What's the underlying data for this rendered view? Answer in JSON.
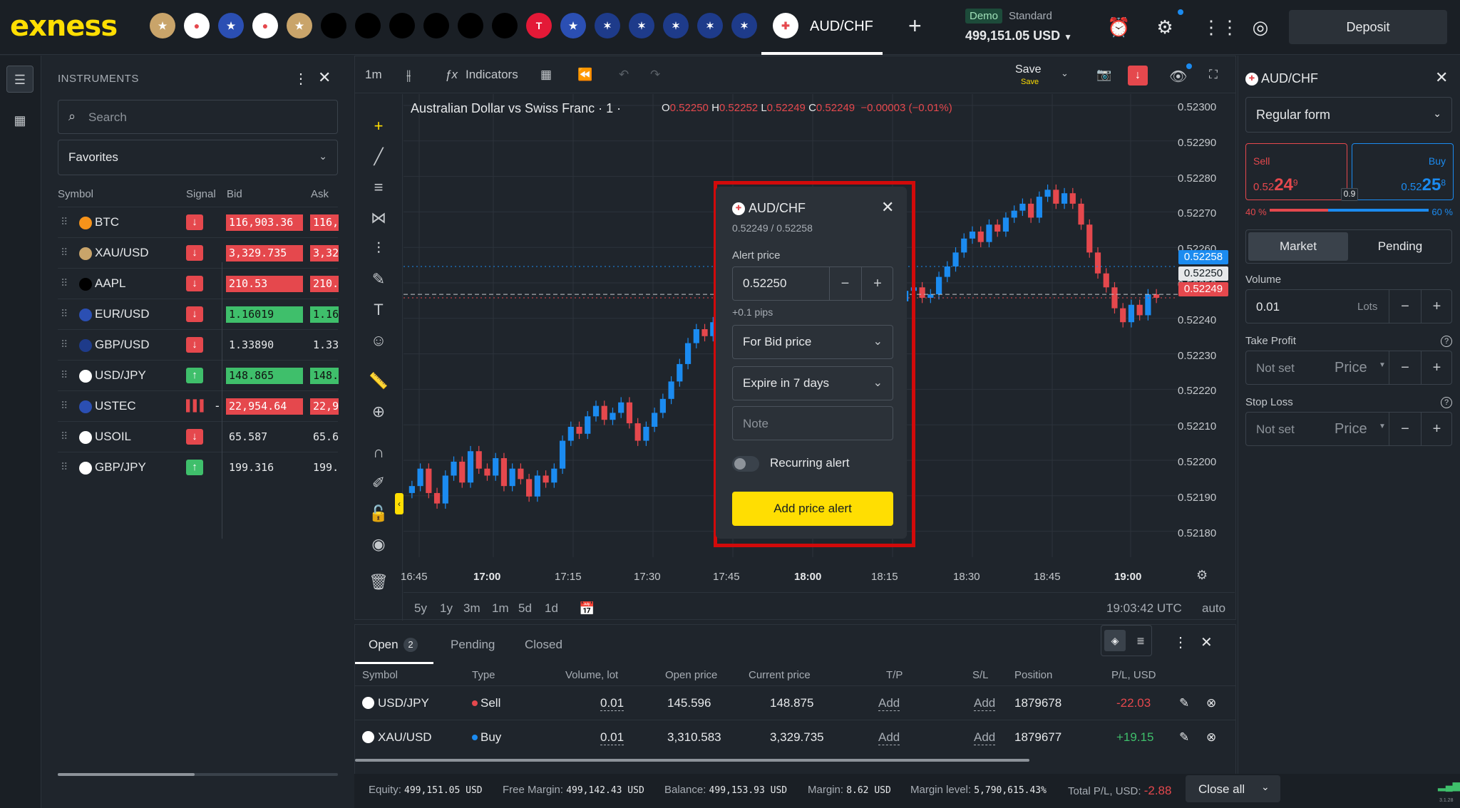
{
  "topbar": {
    "logo": "exness",
    "active_tab": "AUD/CHF",
    "demo_badge": "Demo",
    "account_type": "Standard",
    "balance": "499,151.05 USD",
    "deposit_label": "Deposit",
    "tabs_icons": [
      "xau-usd",
      "usd-jpy",
      "eur-usd",
      "gbp-jpy",
      "xau-usd",
      "aapl",
      "aapl",
      "aapl",
      "aapl",
      "aapl",
      "aapl",
      "tesla",
      "eur-usd",
      "aud-usd",
      "aud-usd",
      "aud-usd",
      "aud-usd",
      "aud-usd"
    ]
  },
  "instruments": {
    "title": "INSTRUMENTS",
    "search_placeholder": "Search",
    "filter_value": "Favorites",
    "columns": [
      "Symbol",
      "Signal",
      "Bid",
      "Ask"
    ],
    "rows": [
      {
        "symbol": "BTC",
        "signal": "down",
        "bid": "116,903.36",
        "ask": "116,",
        "bid_color": "red"
      },
      {
        "symbol": "XAU/USD",
        "signal": "down",
        "bid": "3,329.735",
        "ask": "3,32",
        "bid_color": "red"
      },
      {
        "symbol": "AAPL",
        "signal": "down",
        "bid": "210.53",
        "ask": "210.",
        "bid_color": "red"
      },
      {
        "symbol": "EUR/USD",
        "signal": "down",
        "bid": "1.16019",
        "ask": "1.16",
        "bid_color": "green"
      },
      {
        "symbol": "GBP/USD",
        "signal": "down",
        "bid": "1.33890",
        "ask": "1.33",
        "bid_color": "none"
      },
      {
        "symbol": "USD/JPY",
        "signal": "up",
        "bid": "148.865",
        "ask": "148.",
        "bid_color": "green"
      },
      {
        "symbol": "USTEC",
        "signal": "none",
        "bid": "22,954.64",
        "ask": "22,9",
        "bid_color": "red"
      },
      {
        "symbol": "USOIL",
        "signal": "down",
        "bid": "65.587",
        "ask": "65.6",
        "bid_color": "none"
      },
      {
        "symbol": "GBP/JPY",
        "signal": "up",
        "bid": "199.316",
        "ask": "199.",
        "bid_color": "none"
      }
    ],
    "ustec_signal_text": "-"
  },
  "chart_toolbar": {
    "timeframe": "1m",
    "indicators": "Indicators",
    "save": "Save",
    "save_sub": "Save"
  },
  "chart": {
    "title": "Australian Dollar vs Swiss Franc · 1 ·",
    "ohlc": {
      "o": "0.52250",
      "h": "0.52252",
      "l": "0.52249",
      "c": "0.52249",
      "change": "−0.00003 (−0.01%)"
    },
    "price_axis": [
      "0.52300",
      "0.52290",
      "0.52280",
      "0.52270",
      "0.52260",
      "0.52250",
      "0.52240",
      "0.52230",
      "0.52220",
      "0.52210",
      "0.52200",
      "0.52190",
      "0.52180"
    ],
    "time_axis": [
      "16:45",
      "17:00",
      "17:15",
      "17:30",
      "17:45",
      "18:00",
      "18:15",
      "18:30",
      "18:45",
      "19:00"
    ],
    "tags": {
      "ask": "0.52258",
      "last": "0.52250",
      "bid": "0.52249"
    },
    "ranges": [
      "5y",
      "1y",
      "3m",
      "1m",
      "5d",
      "1d"
    ],
    "clock": "19:03:42 UTC",
    "auto": "auto"
  },
  "chart_data": {
    "type": "candlestick",
    "title": "Australian Dollar vs Swiss Franc · 1 ·",
    "x_range": [
      "16:43",
      "19:03"
    ],
    "ylim": [
      0.52175,
      0.52305
    ],
    "series": [
      {
        "name": "AUD/CHF",
        "close": [
          0.52195,
          0.522,
          0.52193,
          0.5219,
          0.52198,
          0.52202,
          0.52196,
          0.52205,
          0.522,
          0.52198,
          0.52203,
          0.52195,
          0.522,
          0.52197,
          0.52192,
          0.52198,
          0.52196,
          0.522,
          0.52208,
          0.52212,
          0.5221,
          0.52215,
          0.52218,
          0.52214,
          0.52216,
          0.52219,
          0.52213,
          0.52208,
          0.52212,
          0.52216,
          0.5222,
          0.52225,
          0.5223,
          0.52236,
          0.5224,
          0.52238,
          0.52242,
          0.5224,
          0.52244,
          0.52246,
          0.5225,
          0.52254,
          0.52256,
          0.52259,
          0.52254,
          0.52257,
          0.52252,
          0.52254,
          0.52249,
          0.52251,
          0.52248,
          0.5225,
          0.52252,
          0.52251,
          0.52249,
          0.5225,
          0.52253,
          0.5225,
          0.52248,
          0.52251,
          0.52252,
          0.52249,
          0.5225,
          0.52255,
          0.52258,
          0.52262,
          0.52266,
          0.52268,
          0.52265,
          0.5227,
          0.52268,
          0.52272,
          0.52274,
          0.52276,
          0.52272,
          0.52278,
          0.5228,
          0.52276,
          0.52279,
          0.52276,
          0.5227,
          0.52262,
          0.52256,
          0.52252,
          0.52246,
          0.52242,
          0.52247,
          0.52244,
          0.5225,
          0.52249
        ]
      }
    ]
  },
  "alert": {
    "symbol": "AUD/CHF",
    "bid_ask": "0.52249 / 0.52258",
    "price_label": "Alert price",
    "price_value": "0.52250",
    "pips": "+0.1 pips",
    "trigger": "For Bid price",
    "expiry": "Expire in 7 days",
    "note_placeholder": "Note",
    "recurring": "Recurring alert",
    "button": "Add price alert"
  },
  "orders": {
    "tabs": [
      "Open",
      "Pending",
      "Closed"
    ],
    "open_count": "2",
    "columns": [
      "Symbol",
      "Type",
      "Volume, lot",
      "Open price",
      "Current price",
      "T/P",
      "S/L",
      "Position",
      "P/L, USD"
    ],
    "rows": [
      {
        "symbol": "USD/JPY",
        "type": "Sell",
        "volume": "0.01",
        "open": "145.596",
        "current": "148.875",
        "tp": "Add",
        "sl": "Add",
        "position": "1879678",
        "pl": "-22.03"
      },
      {
        "symbol": "XAU/USD",
        "type": "Buy",
        "volume": "0.01",
        "open": "3,310.583",
        "current": "3,329.735",
        "tp": "Add",
        "sl": "Add",
        "position": "1879677",
        "pl": "+19.15"
      }
    ]
  },
  "footer": {
    "equity_l": "Equity:",
    "equity": "499,151.05 USD",
    "free_l": "Free Margin:",
    "free": "499,142.43 USD",
    "balance_l": "Balance:",
    "balance": "499,153.93 USD",
    "margin_l": "Margin:",
    "margin": "8.62 USD",
    "level_l": "Margin level:",
    "level": "5,790,615.43%",
    "total_l": "Total P/L, USD:",
    "total": "-2.88",
    "close_all": "Close all",
    "version": "3.1.28"
  },
  "order_panel": {
    "symbol": "AUD/CHF",
    "form": "Regular form",
    "sell_label": "Sell",
    "sell_small": "0.52",
    "sell_big": "24",
    "sell_sup": "9",
    "buy_label": "Buy",
    "buy_small": "0.52",
    "buy_big": "25",
    "buy_sup": "8",
    "spread": "0.9",
    "sell_pct": "40 %",
    "buy_pct": "60 %",
    "sell_share": 0.4,
    "market": "Market",
    "pending": "Pending",
    "volume_label": "Volume",
    "volume": "0.01",
    "volume_unit": "Lots",
    "tp_label": "Take Profit",
    "tp_value": "Not set",
    "tp_unit": "Price",
    "sl_label": "Stop Loss",
    "sl_value": "Not set",
    "sl_unit": "Price"
  }
}
